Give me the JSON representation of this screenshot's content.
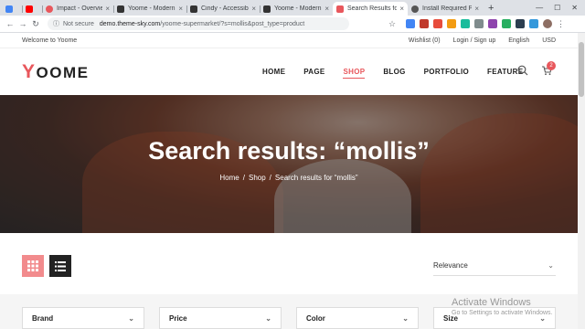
{
  "browser": {
    "tabs": [
      {
        "title": "",
        "color": "#4285f4"
      },
      {
        "title": "",
        "color": "#ff0000"
      },
      {
        "title": "Impact - Overview",
        "color": "#e8575c"
      },
      {
        "title": "Yoome - Modern",
        "color": "#333333"
      },
      {
        "title": "Cindy - Accessibi",
        "color": "#333333"
      },
      {
        "title": "Yoome - Modern",
        "color": "#333333"
      },
      {
        "title": "Search Results fo",
        "color": "#e8575c",
        "active": true
      },
      {
        "title": "Install Required P",
        "color": "#555555"
      }
    ],
    "new_tab": "+",
    "security": "Not secure",
    "url_host": "demo.theme-sky.com",
    "url_rest": "/yoome-supermarket/?s=mollis&post_type=product"
  },
  "topbar": {
    "welcome": "Welcome to Yoome",
    "wishlist": "Wishlist (0)",
    "login": "Login / Sign up",
    "language": "English",
    "currency": "USD"
  },
  "header": {
    "logo_first": "Y",
    "logo_rest": "OOME",
    "menu": [
      "HOME",
      "PAGE",
      "SHOP",
      "BLOG",
      "PORTFOLIO",
      "FEATURE"
    ],
    "active_menu": "SHOP",
    "cart_count": "2"
  },
  "hero": {
    "title": "Search results: “mollis”",
    "breadcrumb": [
      "Home",
      "Shop",
      "Search results for “mollis”"
    ]
  },
  "toolbar": {
    "sort_value": "Relevance"
  },
  "filters": [
    "Brand",
    "Price",
    "Color",
    "Size"
  ],
  "watermark": {
    "line1": "Activate Windows",
    "line2": "Go to Settings to activate Windows."
  },
  "colors": {
    "accent": "#e8575c",
    "grid_button": "#f28b8d",
    "list_button": "#222222"
  }
}
